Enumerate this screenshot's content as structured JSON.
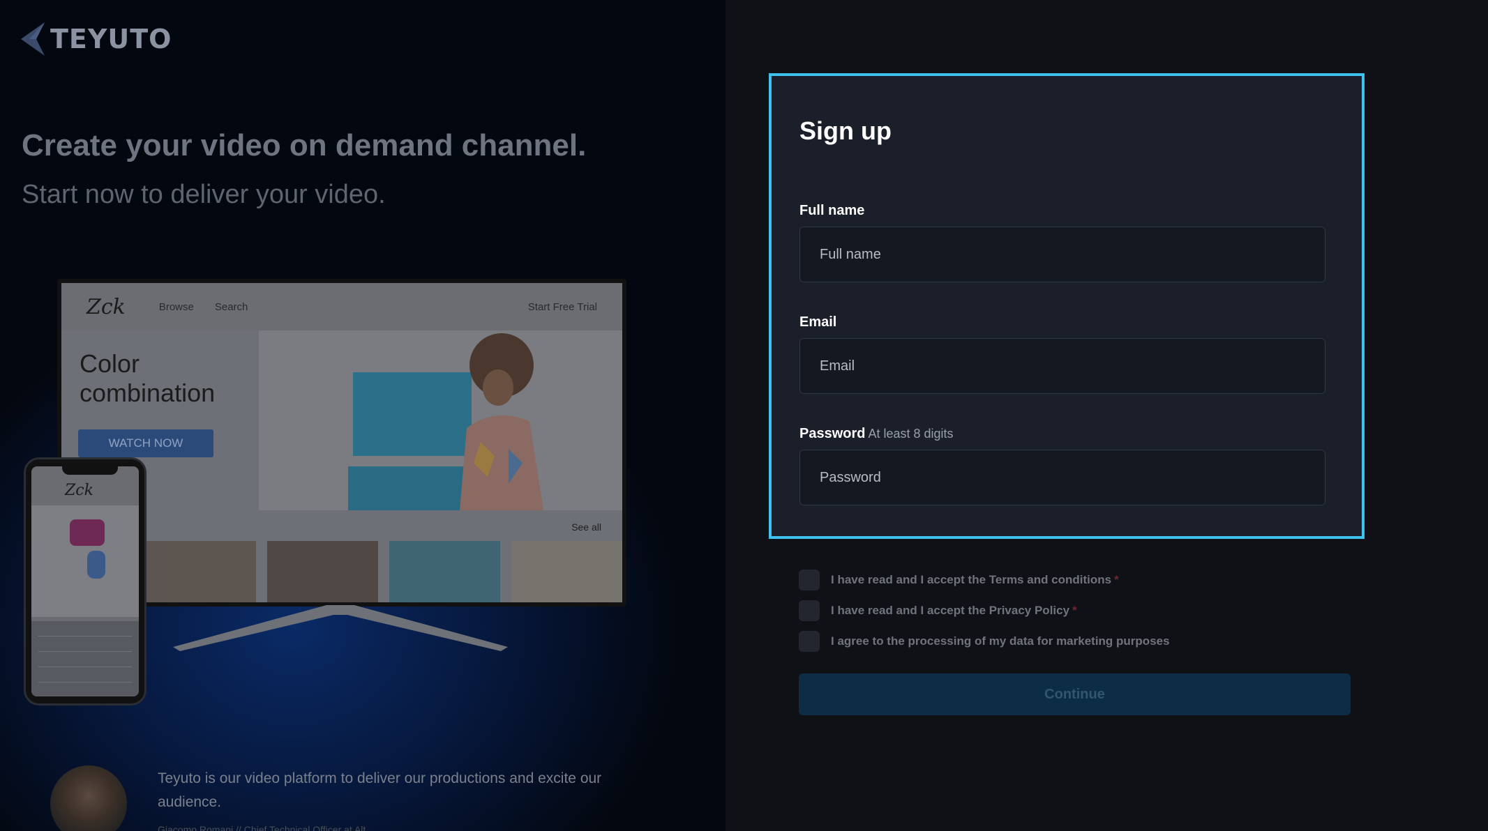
{
  "brand": {
    "name": "TEYUTO"
  },
  "hero": {
    "headline": "Create your video on demand channel.",
    "subline": "Start now to deliver your video."
  },
  "tv_mock": {
    "logo": "Zck",
    "nav": [
      "Browse",
      "Search"
    ],
    "trial": "Start Free Trial",
    "hero_line1": "Color",
    "hero_line2": "combination",
    "watch_now": "WATCH NOW",
    "see_all": "See all"
  },
  "phone_mock": {
    "logo": "Zck"
  },
  "testimonial": {
    "quote": "Teyuto is our video platform to deliver our productions and excite our audience.",
    "author": "Giacomo Romani // Chief Technical Officer at Alt..."
  },
  "signup": {
    "title": "Sign up",
    "full_name_label": "Full name",
    "full_name_placeholder": "Full name",
    "email_label": "Email",
    "email_placeholder": "Email",
    "password_label": "Password",
    "password_hint": "At least 8 digits",
    "password_placeholder": "Password",
    "checks": [
      {
        "label": "I have read and I accept the Terms and conditions",
        "required": "*"
      },
      {
        "label": "I have read and I accept the Privacy Policy",
        "required": "*"
      },
      {
        "label": "I agree to the processing of my data for marketing purposes",
        "required": ""
      }
    ],
    "continue_label": "Continue"
  },
  "colors": {
    "accent_border": "#3ec1ec",
    "card_bg": "#1b1f2a",
    "continue_bg": "#0c2d45"
  }
}
